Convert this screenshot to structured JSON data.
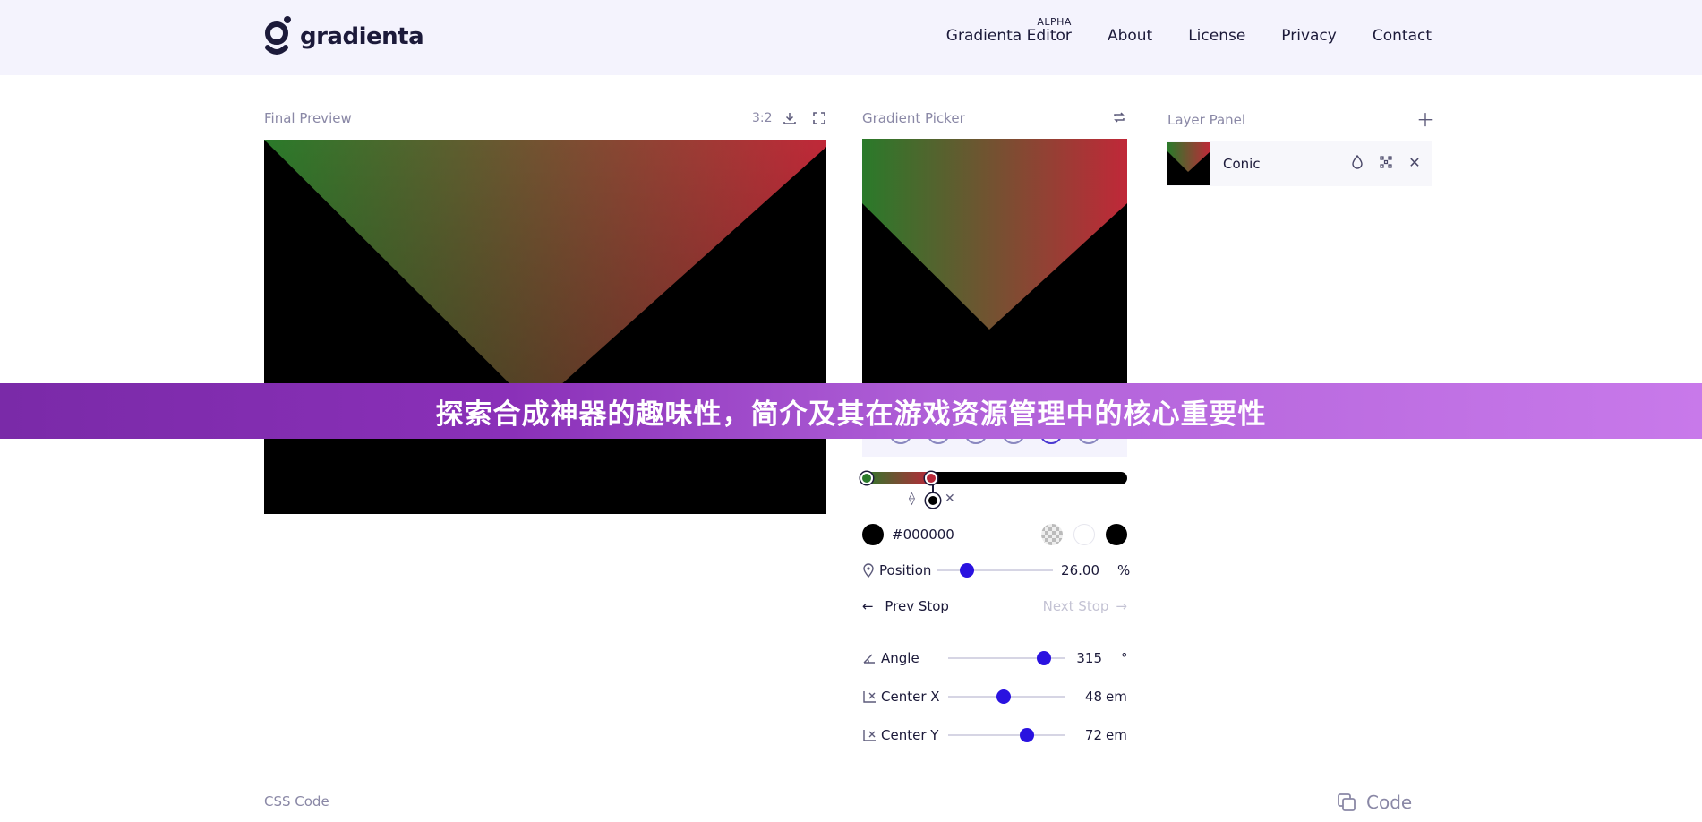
{
  "brand": {
    "name": "gradienta"
  },
  "nav": {
    "items": [
      {
        "label": "Gradienta Editor",
        "badge": "ALPHA"
      },
      {
        "label": "About"
      },
      {
        "label": "License"
      },
      {
        "label": "Privacy"
      },
      {
        "label": "Contact"
      }
    ]
  },
  "final_preview": {
    "title": "Final Preview",
    "ratio": "3:2"
  },
  "gradient_picker": {
    "title": "Gradient Picker",
    "gradient_type": "Conic",
    "stops": [
      {
        "color": "#2a7a2a",
        "position": 0
      },
      {
        "color": "#b8283a",
        "position": 26
      },
      {
        "color": "#000000",
        "position": 26
      }
    ],
    "selected_color": {
      "hex": "#000000"
    },
    "quick_swatches": [
      "transparent",
      "#ffffff",
      "#000000"
    ],
    "position": {
      "label": "Position",
      "value": "26.00",
      "unit": "%",
      "fraction": 0.26
    },
    "prev_stop_label": "Prev Stop",
    "next_stop_label": "Next Stop",
    "angle": {
      "label": "Angle",
      "value": "315",
      "unit": "°",
      "fraction": 0.82
    },
    "center_x": {
      "label": "Center X",
      "value": "48",
      "unit": "em",
      "fraction": 0.48
    },
    "center_y": {
      "label": "Center Y",
      "value": "72",
      "unit": "em",
      "fraction": 0.68
    }
  },
  "layer_panel": {
    "title": "Layer Panel",
    "layers": [
      {
        "name": "Conic"
      }
    ]
  },
  "banner": {
    "text": "探索合成神器的趣味性，简介及其在游戏资源管理中的核心重要性"
  },
  "css_code": {
    "title": "CSS Code",
    "button_label": "Code"
  },
  "colors": {
    "accent": "#2a12e0",
    "banner": "#b060d8",
    "header_bg": "#f4f3fd"
  }
}
